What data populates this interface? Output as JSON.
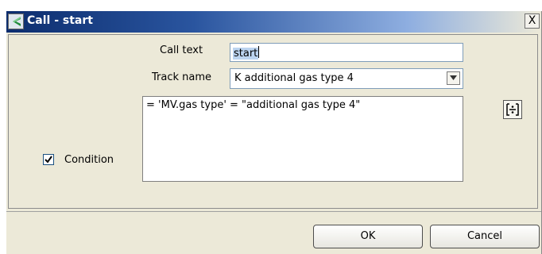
{
  "window": {
    "title": "Call - start",
    "close_label": "X"
  },
  "form": {
    "call_text": {
      "label": "Call text",
      "value": "start"
    },
    "track_name": {
      "label": "Track name",
      "selected": "K additional gas type 4"
    },
    "condition": {
      "label": "Condition",
      "checked": true,
      "value": "= 'MV.gas type' = \"additional gas type 4\""
    }
  },
  "icons": {
    "logo": "app-logo-icon",
    "dropdown": "chevron-down-icon",
    "checkmark": "checkmark-icon",
    "editor": "expression-editor-icon"
  },
  "buttons": {
    "ok": "OK",
    "cancel": "Cancel"
  }
}
